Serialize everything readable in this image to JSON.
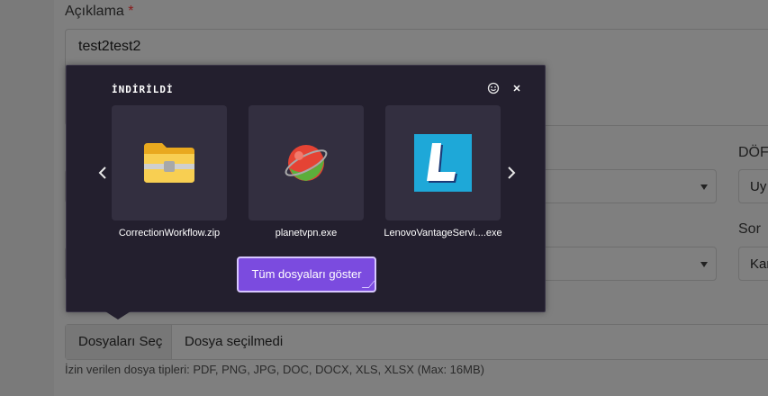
{
  "form": {
    "description_label": "Açıklama",
    "required_mark": "*",
    "description_value": "test2test2",
    "dof_label_partial": "DÖF",
    "select_right_1_partial": "Uy",
    "sorumlu_label_partial": "Sor",
    "select_right_2_partial": "Kar",
    "file_button_label": "Dosyaları Seç",
    "file_status": "Dosya seçilmedi",
    "allowed_types_hint": "İzin verilen dosya tipleri: PDF, PNG, JPG, DOC, DOCX, XLS, XLSX (Max: 16MB)"
  },
  "downloads_popup": {
    "title": "İNDİRİLDİ",
    "items": [
      {
        "name": "CorrectionWorkflow.zip",
        "icon": "zip-folder-icon"
      },
      {
        "name": "planetvpn.exe",
        "icon": "planetvpn-icon"
      },
      {
        "name": "LenovoVantageServi....exe",
        "icon": "lenovo-vantage-icon"
      }
    ],
    "show_all_label": "Tüm dosyaları göster",
    "accent_color": "#7b4bdf"
  }
}
